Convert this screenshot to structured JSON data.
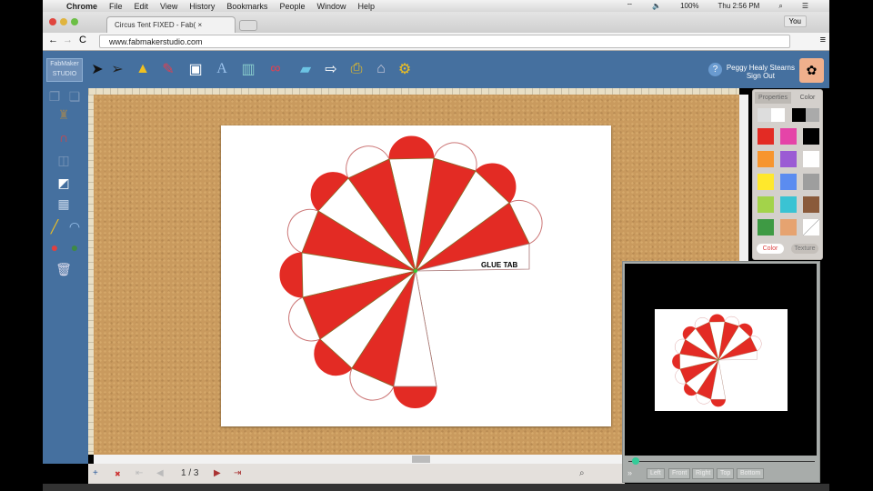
{
  "menubar": {
    "apple": "",
    "items": [
      "Chrome",
      "File",
      "Edit",
      "View",
      "History",
      "Bookmarks",
      "People",
      "Window",
      "Help"
    ],
    "battery": "100%",
    "clock": "Thu 2:56 PM"
  },
  "browser": {
    "tab_title": "Circus Tent FIXED - Fab(",
    "profile": "You",
    "url": "www.fabmakerstudio.com"
  },
  "app": {
    "logo": "FabMaker STUDIO",
    "user_name": "Peggy Healy Stearns",
    "sign_out": "Sign Out",
    "help": "?",
    "toolbar": [
      "select-arrow",
      "direct-select",
      "shapes",
      "draw",
      "library",
      "text",
      "books",
      "glasses",
      "folder",
      "export",
      "print",
      "cut",
      "settings"
    ]
  },
  "canvas": {
    "glue_tab": "GLUE TAB",
    "colors": {
      "red": "#e32b24",
      "cork": "#c99a5e",
      "toolbar": "#45709f"
    }
  },
  "panel": {
    "tabs": [
      "Properties",
      "Color"
    ],
    "swatches": [
      "#e32b24",
      "#e544a8",
      "#000000",
      "#f7952e",
      "#9b5bd4",
      "#ffffff",
      "#ffe82c",
      "#5b8cf0",
      "#9e9e9e",
      "#a3d34a",
      "#3ac3d3",
      "#8a5a3a",
      "#3e9a44",
      "#e6a370",
      "none"
    ],
    "mode_buttons": [
      "Color",
      "Texture"
    ]
  },
  "bottom": {
    "page": "1 / 3"
  },
  "minimap": {
    "views": [
      "Left",
      "Front",
      "Right",
      "Top",
      "Bottom"
    ]
  }
}
